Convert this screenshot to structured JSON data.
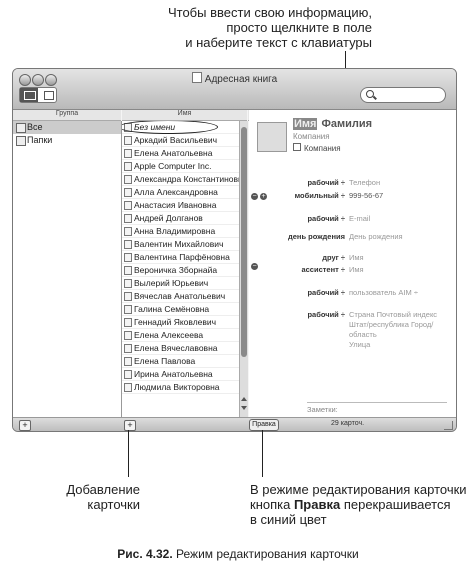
{
  "annotations": {
    "top": [
      "Чтобы ввести свою информацию,",
      "просто щелкните в поле",
      "и наберите текст с клавиатуры"
    ],
    "bottom_left": [
      "Добавление",
      "карточки"
    ],
    "bottom_right_1": "В режиме редактирования карточки",
    "bottom_right_2a": "кнопка ",
    "bottom_right_2b": "Правка",
    "bottom_right_2c": " перекрашивается",
    "bottom_right_3": "в синий цвет"
  },
  "window": {
    "title": "Адресная книга"
  },
  "columns": {
    "group": "Группа",
    "name": "Имя"
  },
  "groups": [
    "Все",
    "Папки"
  ],
  "names": [
    "Без имени",
    "Аркадий Васильевич",
    "Елена Анатольевна",
    "Apple Computer Inc.",
    "Александра Константиновна",
    "Алла Александровна",
    "Анастасия Ивановна",
    "Андрей Долганов",
    "Анна Владимировна",
    "Валентин Михайлович",
    "Валентина Парфёновна",
    "Вероничка Зборнайа",
    "Вылерий Юрьевич",
    "Вячеслав Анатольевич",
    "Галина Семёновна",
    "Геннадий Яковлевич",
    "Елена Алексеева",
    "Елена Вячеславовна",
    "Елена Павлова",
    "Ирина Анатольевна",
    "Людмила Викторовна"
  ],
  "card": {
    "first_name": "Имя",
    "last_name": "Фамилия",
    "company": "Компания",
    "company_checkbox": "Компания",
    "fields": [
      {
        "label": "рабочий ÷",
        "value": "Телефон",
        "placeholder": true
      },
      {
        "label": "мобильный ÷",
        "value": "999-56-67",
        "placeholder": false
      },
      {
        "label": "рабочий ÷",
        "value": "E-mail",
        "placeholder": true
      },
      {
        "label": "день рождения",
        "value": "День рождения",
        "placeholder": true
      },
      {
        "label": "друг ÷",
        "value": "Имя",
        "placeholder": true
      },
      {
        "label": "ассистент ÷",
        "value": "Имя",
        "placeholder": true
      },
      {
        "label": "рабочий ÷",
        "value": "пользователь AIM ÷",
        "placeholder": true
      },
      {
        "label": "рабочий ÷",
        "value": "Страна Почтовый индекс",
        "placeholder": true
      }
    ],
    "address_lines": [
      "Штат/республика Город/",
      "область",
      "Улица"
    ],
    "notes_label": "Заметки:"
  },
  "bottom_bar": {
    "add_group": "+",
    "add_card": "+",
    "edit_button": "Правка",
    "count": "29 карточ."
  },
  "caption": {
    "prefix": "Рис. 4.32.",
    "text": " Режим редактирования карточки"
  }
}
